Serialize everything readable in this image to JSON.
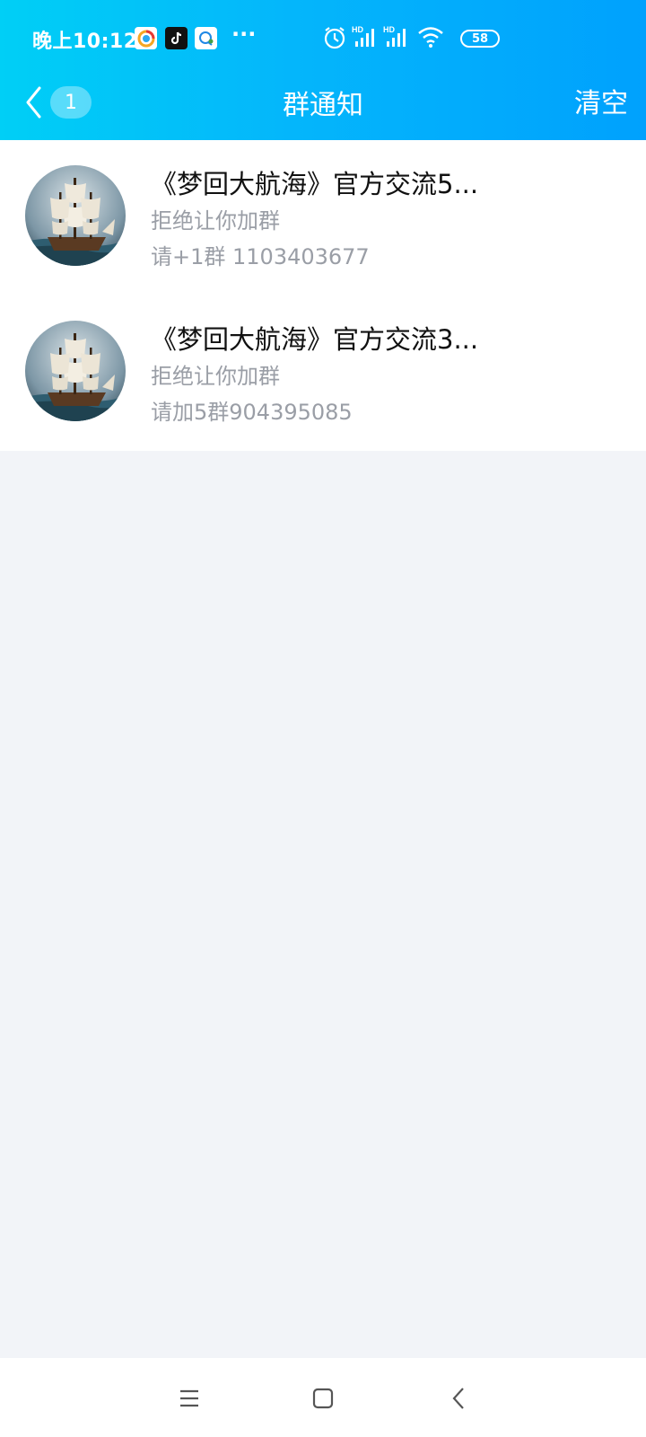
{
  "status_bar": {
    "time": "晚上10:12",
    "more": "···",
    "battery": "58",
    "network_labels": [
      "HD",
      "HD"
    ]
  },
  "nav": {
    "unread_count": "1",
    "title": "群通知",
    "clear_label": "清空"
  },
  "notifications": [
    {
      "title": "《梦回大航海》官方交流5...",
      "status": "拒绝让你加群",
      "message": "请+1群 1103403677",
      "avatar": "sailing-ship-icon"
    },
    {
      "title": "《梦回大航海》官方交流3...",
      "status": "拒绝让你加群",
      "message": "请加5群904395085",
      "avatar": "sailing-ship-icon"
    }
  ],
  "colors": {
    "header_start": "#00cff6",
    "header_end": "#00a1fd",
    "page_bg": "#f2f4f8",
    "secondary_text": "#9a9ea6"
  },
  "system_nav": {
    "icons": [
      "menu-icon",
      "home-icon",
      "back-icon"
    ]
  }
}
